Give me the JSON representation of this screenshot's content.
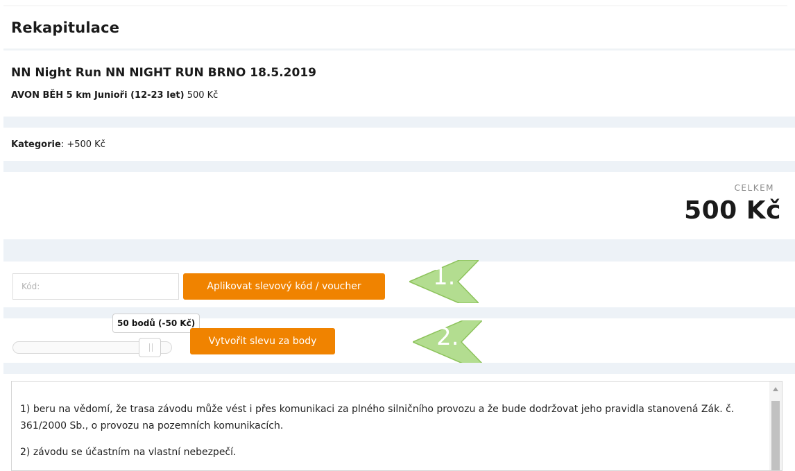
{
  "summary": {
    "title": "Rekapitulace"
  },
  "event": {
    "title": "NN Night Run NN NIGHT RUN BRNO 18.5.2019",
    "race_name": "AVON BĚH 5 km Junioři (12-23 let)",
    "race_price": "500 Kč"
  },
  "category": {
    "label": "Kategorie",
    "value": ": +500 Kč"
  },
  "total": {
    "label": "CELKEM",
    "value": "500 Kč"
  },
  "discount": {
    "code_placeholder": "Kód:",
    "code_value": "",
    "apply_button": "Aplikovat slevový kód / voucher",
    "marker_1": "1.",
    "points_tooltip": "50 bodů (-50 Kč)",
    "points_slider_fraction": 0.93,
    "points_button": "Vytvořit slevu za body",
    "marker_2": "2."
  },
  "terms": {
    "item_1": "1) beru na vědomí, že trasa závodu může vést i přes komunikaci za plného silničního provozu a že bude dodržovat jeho pravidla stanovená Zák. č. 361/2000 Sb., o provozu na pozemních komunikacích.",
    "item_2": "2) závodu se účastním na vlastní nebezpečí."
  },
  "colors": {
    "accent": "#f08300",
    "marker": "#a6d77c",
    "band": "#edf2f7"
  }
}
